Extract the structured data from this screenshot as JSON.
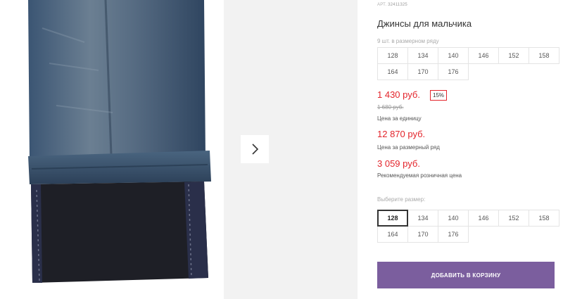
{
  "product": {
    "sku_label": "АРТ.",
    "sku": "32411325",
    "title": "Джинсы для мальчика",
    "size_count": "9 шт. в размерном ряду"
  },
  "size_range": [
    "128",
    "134",
    "140",
    "146",
    "152",
    "158",
    "164",
    "170",
    "176"
  ],
  "pricing": {
    "unit_price": "1 430 руб.",
    "discount": "15%",
    "old_price": "1 680 руб.",
    "unit_caption": "Цена за единицу",
    "set_price": "12 870 руб.",
    "set_caption": "Цена за размерный ряд",
    "rrp_price": "3 059 руб.",
    "rrp_caption": "Рекомендуемая розничная цена"
  },
  "size_picker": {
    "label": "Выберите размер:",
    "options": [
      "128",
      "134",
      "140",
      "146",
      "152",
      "158",
      "164",
      "170",
      "176"
    ],
    "selected": "128"
  },
  "cart": {
    "button_label": "ДОБАВИТЬ В КОРЗИНУ"
  },
  "gallery": {
    "next_icon": "chevron-right-icon"
  },
  "colors": {
    "price": "#e3242b",
    "button": "#7b5e9e",
    "denim": "#3e5673",
    "lining": "#1f1f24"
  }
}
